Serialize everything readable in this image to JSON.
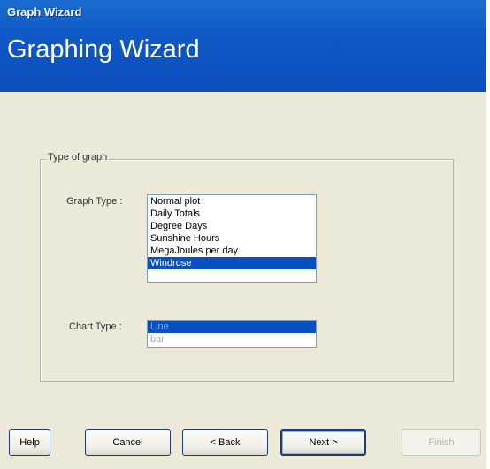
{
  "window": {
    "title": "Graph Wizard",
    "header_title": "Graphing Wizard"
  },
  "group": {
    "legend": "Type of graph",
    "graph_type_label": "Graph Type :",
    "graph_types": [
      "Normal plot",
      "Daily Totals",
      "Degree Days",
      "Sunshine Hours",
      "MegaJoules per day",
      "Windrose"
    ],
    "graph_type_selected": "Windrose",
    "chart_type_label": "Chart Type :",
    "chart_types": [
      "Line",
      "bar"
    ],
    "chart_type_selected": "Line",
    "chart_type_enabled": false
  },
  "buttons": {
    "help": "Help",
    "cancel": "Cancel",
    "back": "< Back",
    "next": "Next >",
    "finish": "Finish",
    "finish_enabled": false
  },
  "colors": {
    "title_bar": "#0f58c6",
    "selection": "#0a4fc0",
    "dialog_background": "#ece9d8"
  }
}
